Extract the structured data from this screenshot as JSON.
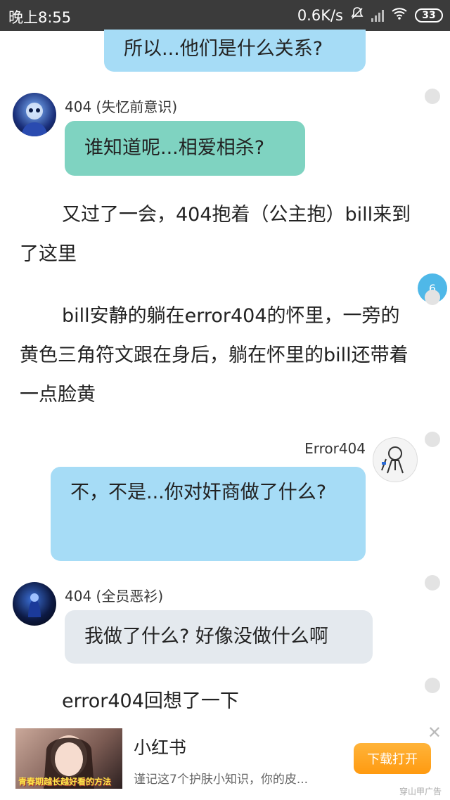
{
  "status_bar": {
    "time": "晚上8:55",
    "speed": "0.6K/s",
    "battery": "33"
  },
  "messages": {
    "m1_text": "所以...他们是什么关系?",
    "m2_name": "404 (失忆前意识)",
    "m2_text": "谁知道呢...相爱相杀?",
    "narr1": "又过了一会，404抱着（公主抱）bill来到了这里",
    "narr2": "bill安静的躺在error404的怀里，一旁的黄色三角符文跟在身后，躺在怀里的bill还带着一点脸黄",
    "m3_name": "Error404",
    "m3_text": "不，不是...你对奸商做了什么?",
    "m4_name": "404 (全员恶衫)",
    "m4_text": "我做了什么? 好像没做什么啊",
    "narr3": "error404回想了一下"
  },
  "badge_count": "6",
  "ad": {
    "thumb_caption": "青春期越长越好看的方法",
    "title": "小红书",
    "desc": "谨记这7个护肤小知识，你的皮...",
    "button": "下载打开",
    "close": "✕",
    "label": "穿山甲广告"
  },
  "colors": {
    "teal_bubble": "#7fd3c1",
    "blue_bubble": "#a6dcf6",
    "grey_bubble": "#e4e9ee",
    "badge": "#4fb8e8"
  }
}
